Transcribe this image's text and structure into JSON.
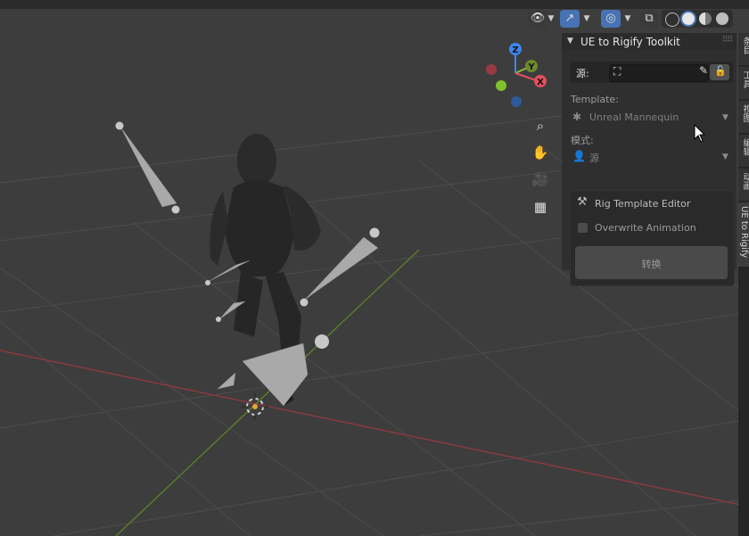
{
  "header": {
    "view_icon": "eye-icon",
    "gizmo_icon": "gizmo-icon",
    "overlay_icon": "overlay-icon",
    "xray_icon": "xray-icon",
    "shading_modes": [
      "wireframe-shading-icon",
      "solid-shading-icon",
      "material-shading-icon",
      "rendered-shading-icon"
    ]
  },
  "panel": {
    "title": "UE to Rigify Toolkit",
    "source_label": "源:",
    "template_label": "Template:",
    "template_value": "Unreal Mannequin",
    "mode_label": "模式:",
    "mode_value": "源",
    "rig_editor_label": "Rig Template Editor",
    "overwrite_label": "Overwrite Animation",
    "overwrite_checked": false,
    "convert_label": "转换"
  },
  "gizmo": {
    "x": "X",
    "y": "Y",
    "z": "Z"
  },
  "tabs": [
    {
      "label": "条目",
      "active": false
    },
    {
      "label": "工具",
      "active": false
    },
    {
      "label": "视图",
      "active": false
    },
    {
      "label": "编辑",
      "active": false
    },
    {
      "label": "动画",
      "active": false
    },
    {
      "label": "UE to Rigify",
      "active": true
    }
  ],
  "colors": {
    "x_axis": "#e24e5e",
    "y_axis": "#8cbf2f",
    "z_axis": "#3e86ea",
    "accent": "#4772b3"
  }
}
